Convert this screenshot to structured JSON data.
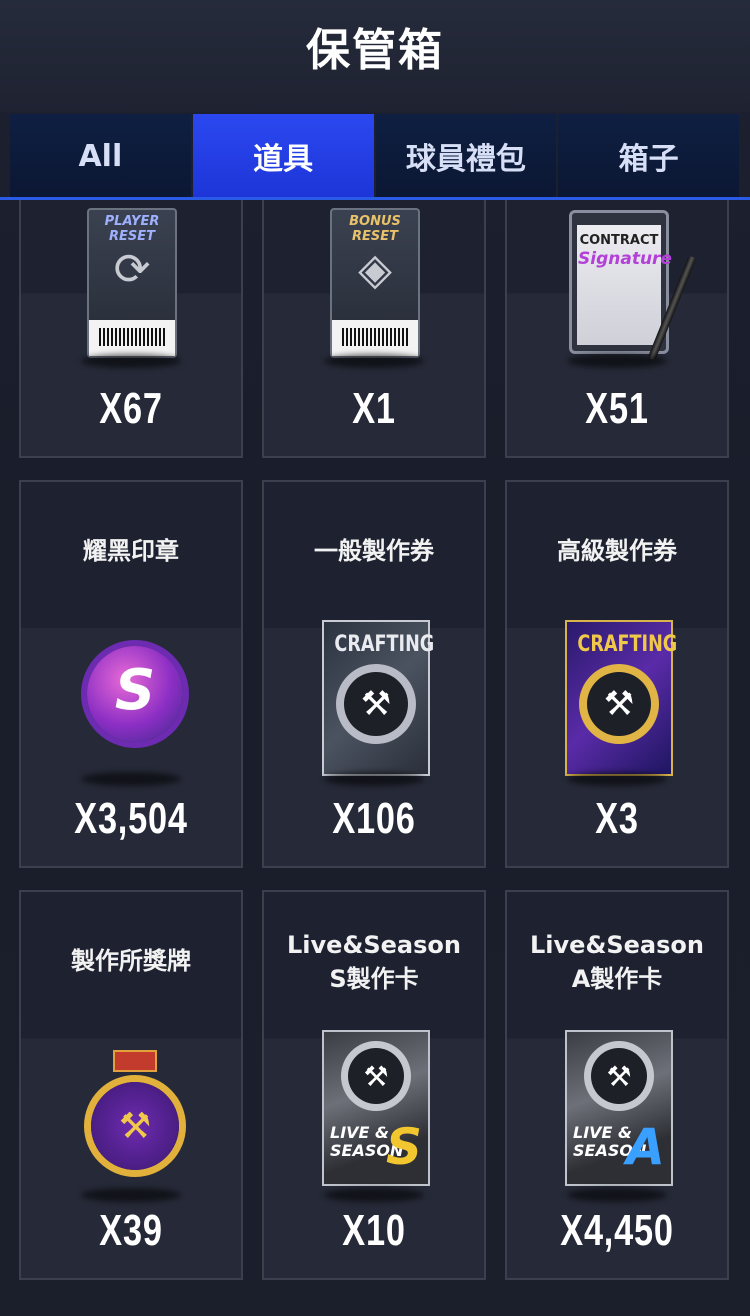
{
  "header": {
    "title": "保管箱"
  },
  "tabs": [
    {
      "label": "All",
      "active": false
    },
    {
      "label": "道具",
      "active": true
    },
    {
      "label": "球員禮包",
      "active": false
    },
    {
      "label": "箱子",
      "active": false
    }
  ],
  "items": [
    {
      "name": "",
      "icon_text": "PLAYER RESET",
      "quantity": "X67",
      "icon": "player-reset-ticket"
    },
    {
      "name": "",
      "icon_text": "BONUS RESET",
      "quantity": "X1",
      "icon": "bonus-reset-ticket"
    },
    {
      "name": "",
      "icon_text": "CONTRACT",
      "icon_text2": "Signature",
      "quantity": "X51",
      "icon": "contract-clipboard"
    },
    {
      "name": "耀黑印章",
      "icon_text": "S",
      "quantity": "X3,504",
      "icon": "wax-seal"
    },
    {
      "name": "一般製作券",
      "icon_text": "CRAFTING",
      "quantity": "X106",
      "icon": "crafting-ticket-silver"
    },
    {
      "name": "高級製作券",
      "icon_text": "CRAFTING",
      "quantity": "X3",
      "icon": "crafting-ticket-gold"
    },
    {
      "name": "製作所獎牌",
      "quantity": "X39",
      "icon": "crafting-medal"
    },
    {
      "name": "Live&Season",
      "name2": "S製作卡",
      "icon_text": "LIVE &",
      "icon_text2": "SEASON",
      "grade": "S",
      "quantity": "X10",
      "icon": "live-season-s-card"
    },
    {
      "name": "Live&Season",
      "name2": "A製作卡",
      "icon_text": "LIVE &",
      "icon_text2": "SEASON",
      "grade": "A",
      "quantity": "X4,450",
      "icon": "live-season-a-card"
    }
  ],
  "colors": {
    "tab_active": "#2b48f0",
    "tab_inactive": "#0f1f42",
    "grade_s": "#f2c62e",
    "grade_a": "#3aa0ff"
  }
}
